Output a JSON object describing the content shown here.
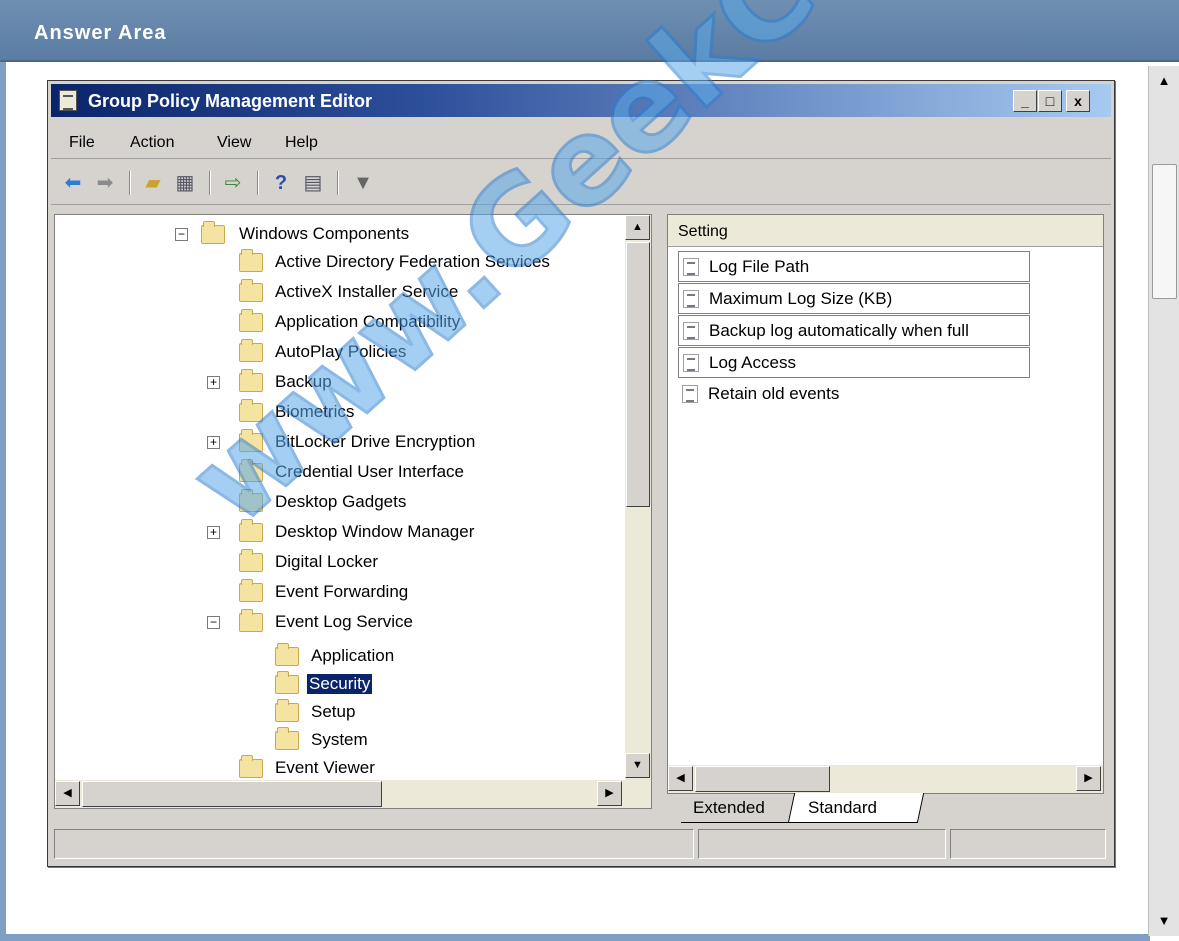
{
  "page": {
    "answer_area_title": "Answer Area"
  },
  "window": {
    "title": "Group Policy Management Editor",
    "controls": {
      "minimize": "_",
      "maximize": "□",
      "close": "x"
    }
  },
  "menu": [
    "File",
    "Action",
    "View",
    "Help"
  ],
  "toolbar_icons": [
    "back-icon",
    "forward-icon",
    "up-folder-icon",
    "show-hide-tree-icon",
    "export-list-icon",
    "help-icon",
    "properties-icon",
    "filter-icon"
  ],
  "tree": {
    "items": [
      {
        "label": "Windows Components",
        "expander": "minus"
      },
      {
        "label": "Active Directory Federation Services",
        "expander": ""
      },
      {
        "label": "ActiveX Installer Service",
        "expander": ""
      },
      {
        "label": "Application Compatibility",
        "expander": ""
      },
      {
        "label": "AutoPlay Policies",
        "expander": ""
      },
      {
        "label": "Backup",
        "expander": "plus"
      },
      {
        "label": "Biometrics",
        "expander": ""
      },
      {
        "label": "BitLocker Drive Encryption",
        "expander": "plus"
      },
      {
        "label": "Credential User Interface",
        "expander": ""
      },
      {
        "label": "Desktop Gadgets",
        "expander": ""
      },
      {
        "label": "Desktop Window Manager",
        "expander": "plus"
      },
      {
        "label": "Digital Locker",
        "expander": ""
      },
      {
        "label": "Event Forwarding",
        "expander": ""
      },
      {
        "label": "Event Log Service",
        "expander": "minus"
      },
      {
        "label": "Application",
        "expander": ""
      },
      {
        "label": "Security",
        "expander": "",
        "selected": true
      },
      {
        "label": "Setup",
        "expander": ""
      },
      {
        "label": "System",
        "expander": ""
      },
      {
        "label": "Event Viewer",
        "expander": ""
      }
    ]
  },
  "settings": {
    "header": "Setting",
    "items": [
      "Log File Path",
      "Maximum Log Size (KB)",
      "Backup log automatically when full",
      "Log Access",
      "Retain old events"
    ]
  },
  "tabs": {
    "extended": "Extended",
    "standard": "Standard",
    "active": "Standard"
  },
  "watermark": "www.GeekCert.com",
  "colors": {
    "selection": "#0a246a",
    "titlebar_start": "#0a246a",
    "titlebar_end": "#a6caf0",
    "answer_bar": "#5b7ca3",
    "watermark": "#5aa9e8"
  }
}
